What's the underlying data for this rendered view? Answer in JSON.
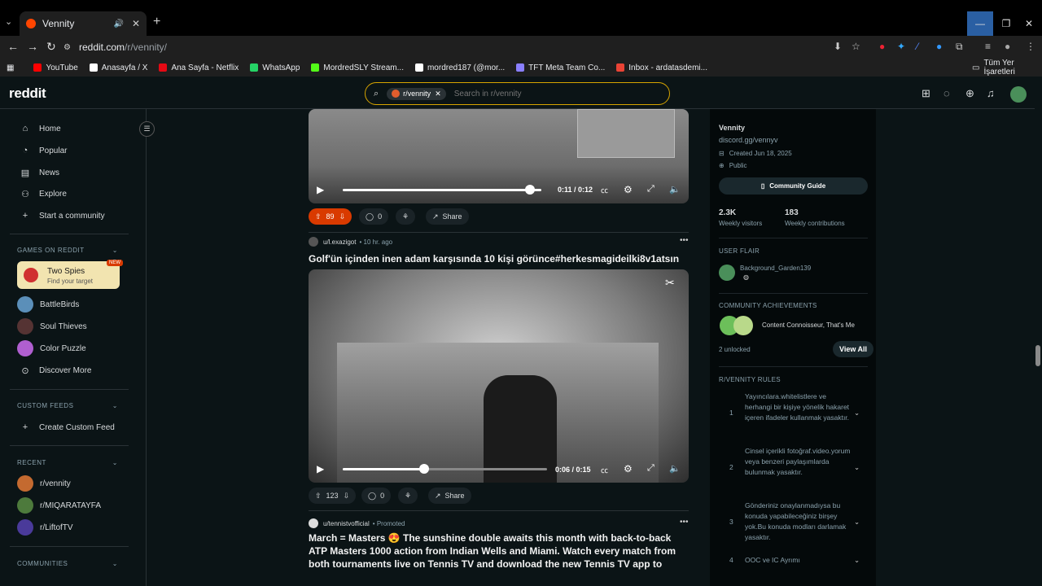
{
  "browser": {
    "tab_title": "Vennity",
    "url_host": "reddit.com",
    "url_path": "/r/vennity/",
    "new_tab": "+",
    "bookmarks": [
      {
        "label": "YouTube",
        "color": "#ff0000"
      },
      {
        "label": "Anasayfa / X",
        "color": "#ffffff"
      },
      {
        "label": "Ana Sayfa - Netflix",
        "color": "#e50914"
      },
      {
        "label": "WhatsApp",
        "color": "#25d366"
      },
      {
        "label": "MordredSLY Stream...",
        "color": "#53fc18"
      },
      {
        "label": "mordred187 (@mor...",
        "color": "#ffffff"
      },
      {
        "label": "TFT Meta Team Co...",
        "color": "#8a7fff"
      },
      {
        "label": "Inbox - ardatasdemi...",
        "color": "#ea4335"
      }
    ],
    "all_bookmarks": "Tüm Yer İşaretleri"
  },
  "header": {
    "logo": "reddit",
    "search_chip": "r/vennity",
    "search_placeholder": "Search in r/vennity"
  },
  "sidebar": {
    "nav": [
      "Home",
      "Popular",
      "News",
      "Explore",
      "Start a community"
    ],
    "games_heading": "GAMES ON REDDIT",
    "featured_game": {
      "name": "Two Spies",
      "tagline": "Find your target",
      "badge": "NEW"
    },
    "games": [
      "BattleBirds",
      "Soul Thieves",
      "Color Puzzle",
      "Discover More"
    ],
    "custom_heading": "CUSTOM FEEDS",
    "create_feed": "Create Custom Feed",
    "recent_heading": "RECENT",
    "recent": [
      "r/vennity",
      "r/MIQARATAYFA",
      "r/LiftofTV"
    ],
    "communities_heading": "COMMUNITIES"
  },
  "post1": {
    "time": "0:11 / 0:12",
    "progress": 0.92,
    "votes": "89",
    "comments": "0",
    "share": "Share"
  },
  "post2": {
    "user": "u/l.exazigot",
    "age": "10 hr. ago",
    "title": "Golf'ün içinden inen adam karşısında 10 kişi görünce#herkesmagideilki8v1atsın",
    "time": "0:06 / 0:15",
    "progress": 0.4,
    "votes": "123",
    "comments": "0",
    "share": "Share"
  },
  "post3": {
    "user": "u/tennistvofficial",
    "tag": "Promoted",
    "title": "March = Masters 😍 The sunshine double awaits this month with back-to-back ATP Masters 1000 action from Indian Wells and Miami. Watch every match from both tournaments live on Tennis TV and download the new Tennis TV app to take the"
  },
  "community": {
    "name": "Vennity",
    "link": "discord.gg/vennyv",
    "created": "Created Jun 18, 2025",
    "visibility": "Public",
    "guide": "Community Guide",
    "visitors": "2.3K",
    "visitors_label": "Weekly visitors",
    "contribs": "183",
    "contribs_label": "Weekly contributions",
    "flair_heading": "USER FLAIR",
    "flair_user": "Background_Garden139",
    "ach_heading": "COMMUNITY ACHIEVEMENTS",
    "ach_text": "Content Connoisseur, That's Me",
    "unlocked": "2 unlocked",
    "view_all": "View All",
    "rules_heading": "R/VENNITY RULES",
    "rules": [
      {
        "n": "1",
        "text": "Yayıncılara.whitelistlere ve herhangi bir kişiye yönelik hakaret içeren ifadeler kullanmak yasaktır."
      },
      {
        "n": "2",
        "text": "Cinsel içerikli fotoğraf.video.yorum veya benzeri paylaşımlarda bulunmak yasaktır."
      },
      {
        "n": "3",
        "text": "Gönderiniz onaylanmadıysa bu konuda yapabileceğiniz birşey yok.Bu konuda modları darlamak yasaktır."
      },
      {
        "n": "4",
        "text": "OOC ve IC Ayrımı"
      }
    ]
  }
}
